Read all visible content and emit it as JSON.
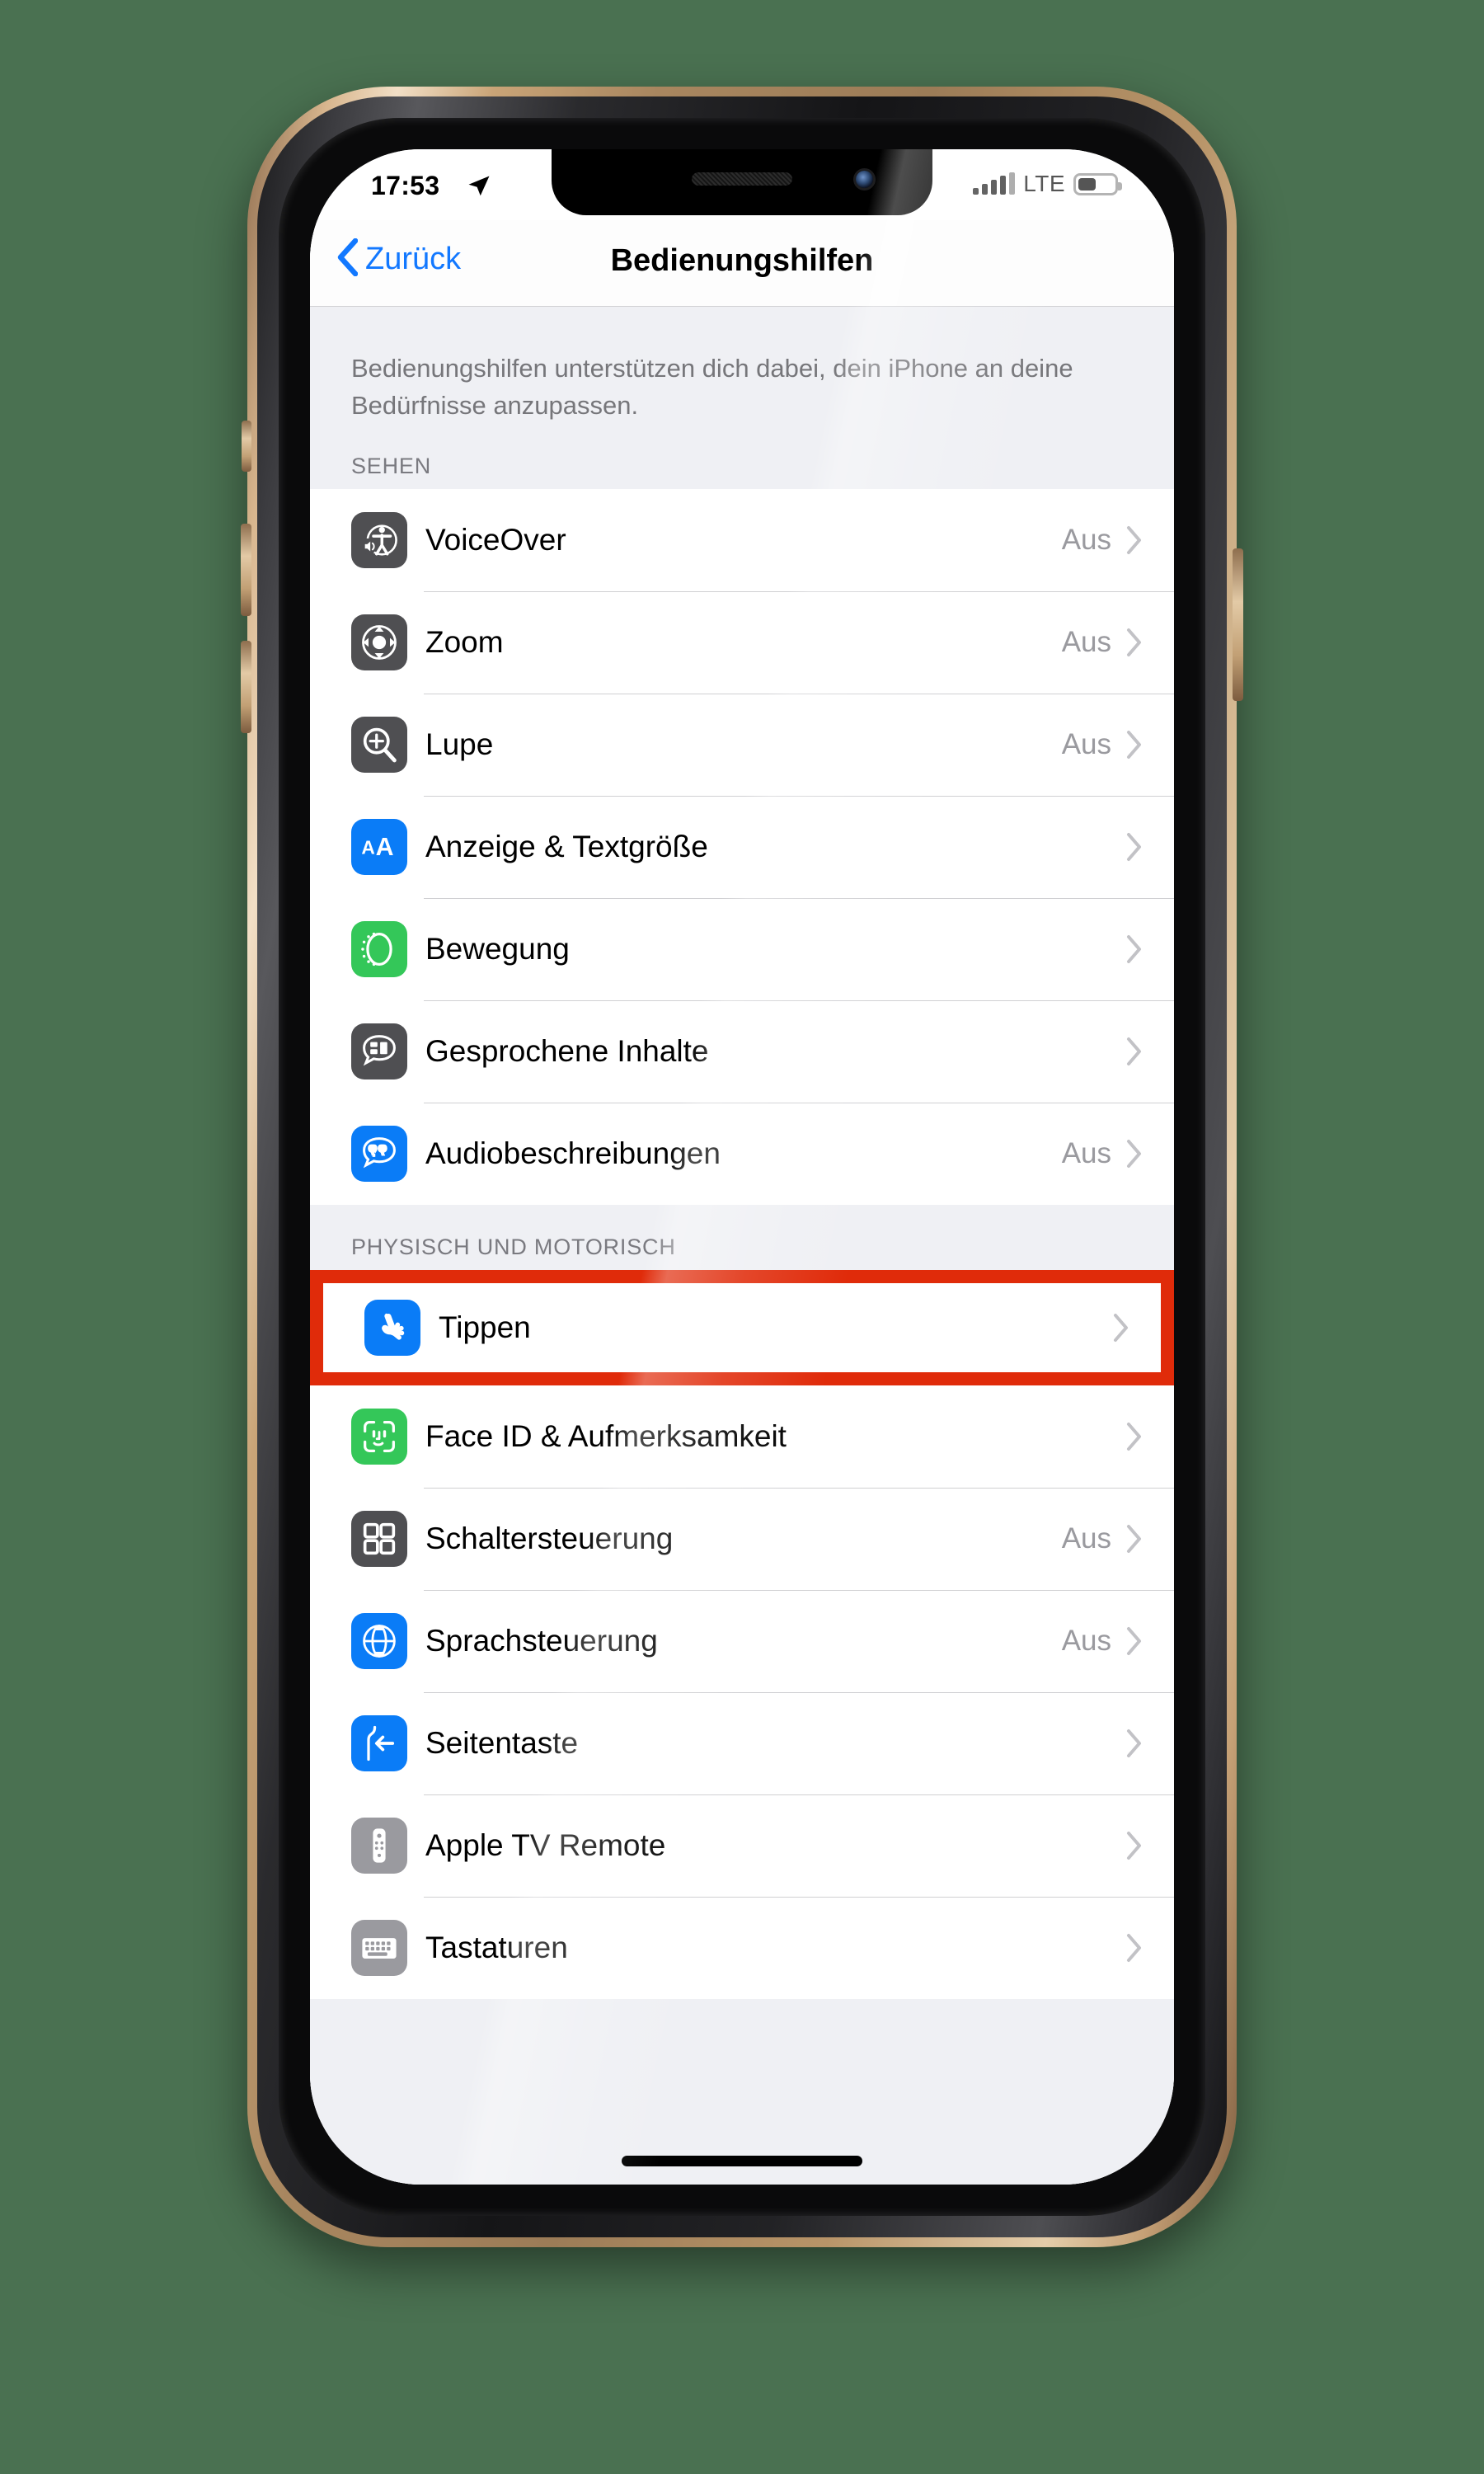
{
  "device": {
    "name": "iphone-gold",
    "background_color": "#4a7151",
    "frame_color": "#c9a477"
  },
  "status_bar": {
    "time": "17:53",
    "location_icon": "location-arrow-icon",
    "signal_icon": "cellular-signal-icon",
    "signal_bars_filled": 4,
    "signal_bars_total": 5,
    "carrier": "LTE",
    "battery_icon": "battery-icon",
    "battery_percent": 44
  },
  "nav": {
    "back_icon": "chevron-left-icon",
    "back_label": "Zurück",
    "title": "Bedienungshilfen"
  },
  "intro": {
    "text": "Bedienungshilfen unterstützen dich dabei, dein iPhone an deine Bedürfnisse anzupassen."
  },
  "highlight": {
    "color": "#e02b0a",
    "target_row": "Tippen"
  },
  "sections": [
    {
      "header": "SEHEN",
      "rows": [
        {
          "label": "VoiceOver",
          "value": "Aus",
          "icon": "voiceover-icon",
          "icon_color": "#4f4f52"
        },
        {
          "label": "Zoom",
          "value": "Aus",
          "icon": "zoom-icon",
          "icon_color": "#4f4f52"
        },
        {
          "label": "Lupe",
          "value": "Aus",
          "icon": "magnifier-icon",
          "icon_color": "#4f4f52"
        },
        {
          "label": "Anzeige & Textgröße",
          "value": "",
          "icon": "display-text-size-icon",
          "icon_color": "#0a7cf7"
        },
        {
          "label": "Bewegung",
          "value": "",
          "icon": "motion-icon",
          "icon_color": "#34c759"
        },
        {
          "label": "Gesprochene Inhalte",
          "value": "",
          "icon": "spoken-content-icon",
          "icon_color": "#4f4f52"
        },
        {
          "label": "Audiobeschreibungen",
          "value": "Aus",
          "icon": "audio-descriptions-icon",
          "icon_color": "#0a7cf7"
        }
      ]
    },
    {
      "header": "PHYSISCH UND MOTORISCH",
      "rows": [
        {
          "label": "Tippen",
          "value": "",
          "icon": "touch-hand-icon",
          "icon_color": "#0a7cf7",
          "highlighted": true
        },
        {
          "label": "Face ID & Aufmerksamkeit",
          "value": "",
          "icon": "face-id-icon",
          "icon_color": "#34c759"
        },
        {
          "label": "Schaltersteuerung",
          "value": "Aus",
          "icon": "switch-control-icon",
          "icon_color": "#4f4f52"
        },
        {
          "label": "Sprachsteuerung",
          "value": "Aus",
          "icon": "voice-control-icon",
          "icon_color": "#0a7cf7"
        },
        {
          "label": "Seitentaste",
          "value": "",
          "icon": "side-button-icon",
          "icon_color": "#0a7cf7"
        },
        {
          "label": "Apple TV Remote",
          "value": "",
          "icon": "apple-tv-remote-icon",
          "icon_color": "#9a9a9f"
        },
        {
          "label": "Tastaturen",
          "value": "",
          "icon": "keyboards-icon",
          "icon_color": "#9a9a9f"
        }
      ]
    }
  ]
}
